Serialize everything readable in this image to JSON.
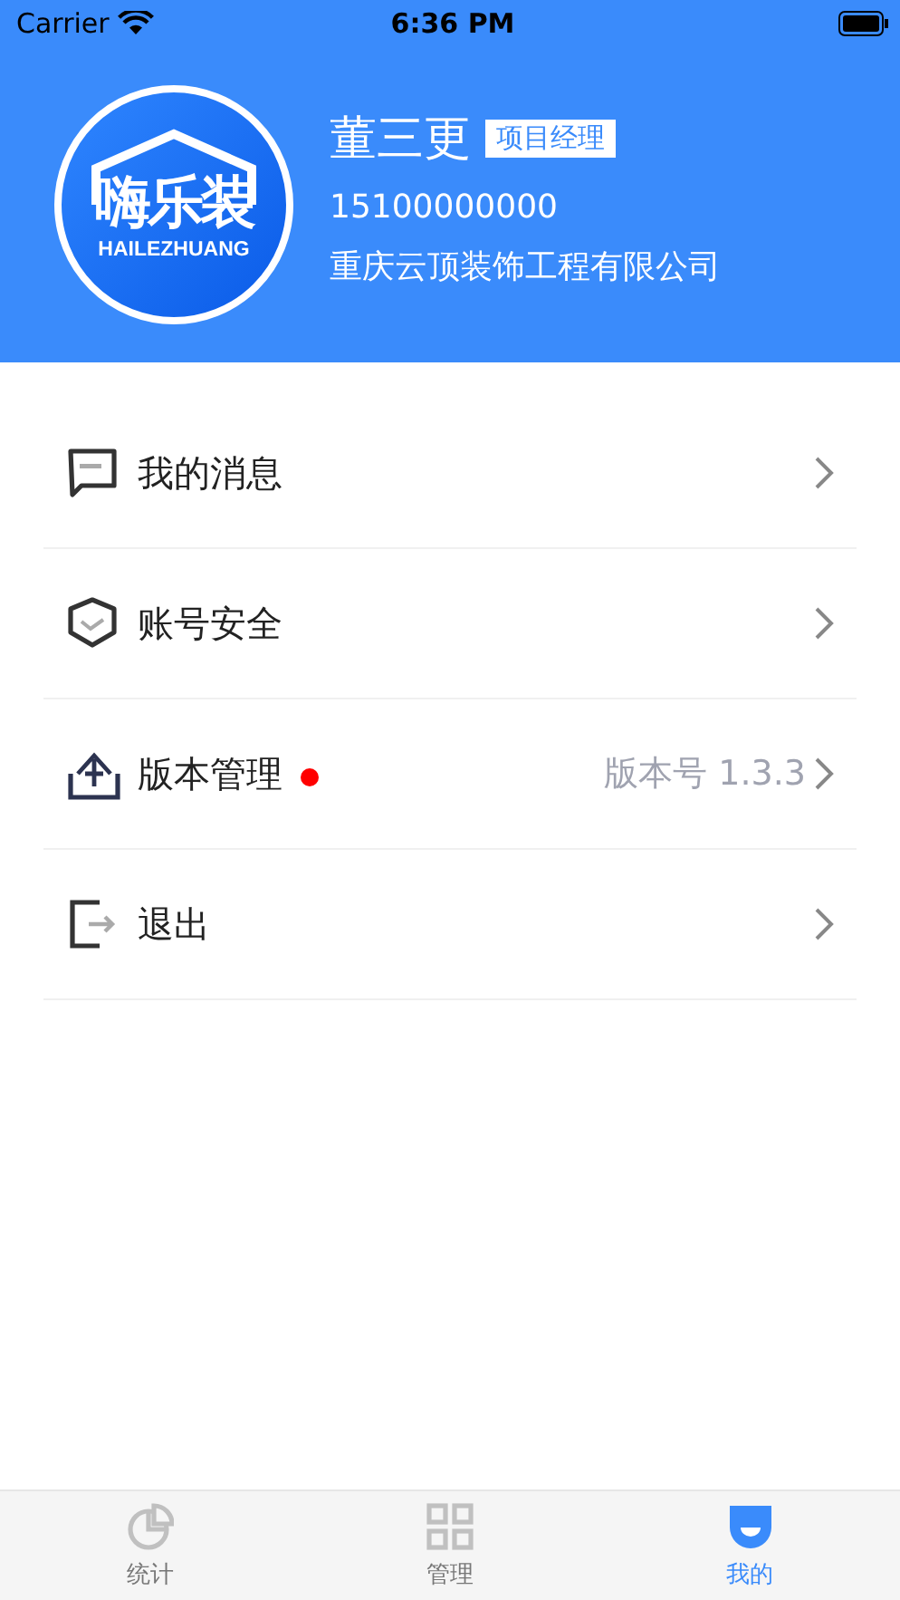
{
  "status_bar": {
    "carrier": "Carrier",
    "time": "6:36 PM"
  },
  "profile": {
    "logo_text": "嗨乐装",
    "logo_subtext": "HAILEZHUANG",
    "name": "董三更",
    "role": "项目经理",
    "phone": "15100000000",
    "company": "重庆云顶装饰工程有限公司"
  },
  "menu": [
    {
      "kind": "message",
      "label": "我的消息",
      "badge": false
    },
    {
      "kind": "shield",
      "label": "账号安全",
      "badge": false
    },
    {
      "kind": "upload",
      "label": "版本管理",
      "badge": true,
      "value": "版本号 1.3.3"
    },
    {
      "kind": "logout",
      "label": "退出",
      "badge": false
    }
  ],
  "tabs": [
    {
      "kind": "stats",
      "label": "统计",
      "selected": false
    },
    {
      "kind": "grid",
      "label": "管理",
      "selected": false
    },
    {
      "kind": "me",
      "label": "我的",
      "selected": true
    }
  ]
}
